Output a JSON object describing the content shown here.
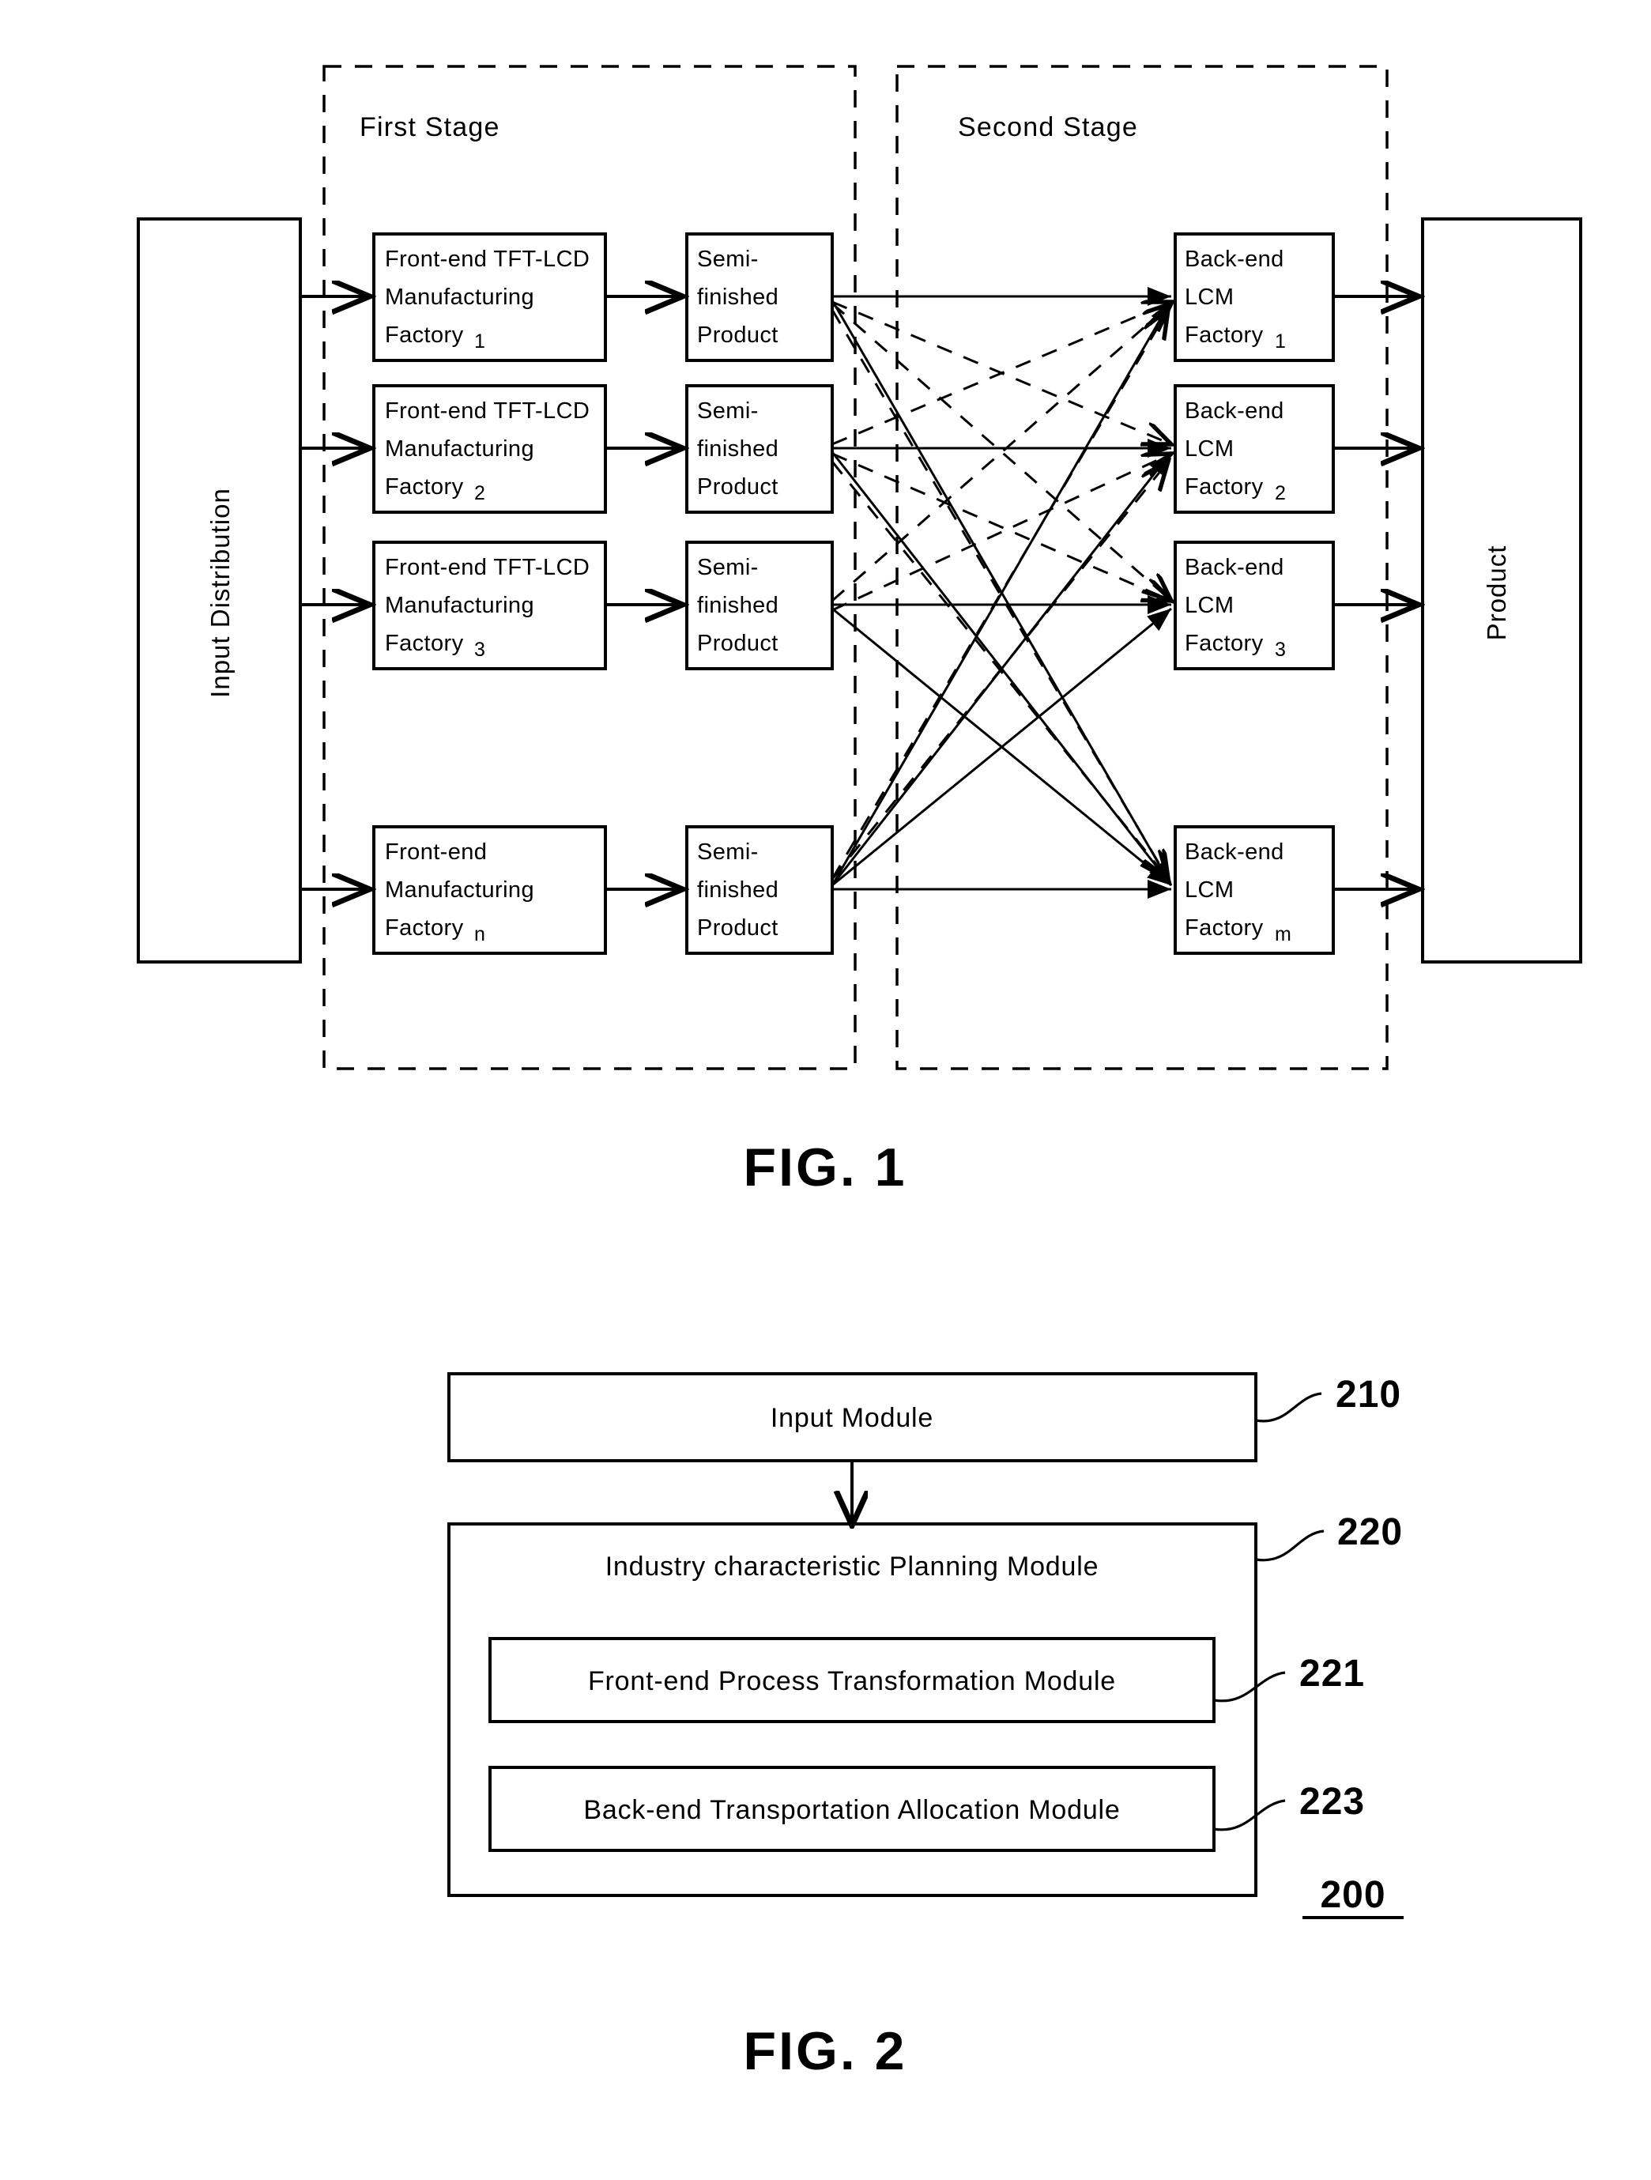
{
  "figure1": {
    "caption": "FIG. 1",
    "stages": [
      {
        "id": "first-stage",
        "label": "First Stage"
      },
      {
        "id": "second-stage",
        "label": "Second Stage"
      }
    ],
    "input_block": {
      "label": "Input Distribution"
    },
    "output_block": {
      "label": "Product"
    },
    "frontend_factories": [
      {
        "line1": "Front-end TFT-LCD",
        "line2": "Manufacturing",
        "line3": "Factory",
        "index": "1"
      },
      {
        "line1": "Front-end TFT-LCD",
        "line2": "Manufacturing",
        "line3": "Factory",
        "index": "2"
      },
      {
        "line1": "Front-end TFT-LCD",
        "line2": "Manufacturing",
        "line3": "Factory",
        "index": "3"
      },
      {
        "line1": "Front-end",
        "line2": "Manufacturing",
        "line3": "Factory",
        "index": "n"
      }
    ],
    "semifinished": [
      {
        "line1": "Semi-",
        "line2": "finished",
        "line3": "Product"
      },
      {
        "line1": "Semi-",
        "line2": "finished",
        "line3": "Product"
      },
      {
        "line1": "Semi-",
        "line2": "finished",
        "line3": "Product"
      },
      {
        "line1": "Semi-",
        "line2": "finished",
        "line3": "Product"
      }
    ],
    "backend_factories": [
      {
        "line1": "Back-end",
        "line2": "LCM",
        "line3": "Factory",
        "index": "1"
      },
      {
        "line1": "Back-end",
        "line2": "LCM",
        "line3": "Factory",
        "index": "2"
      },
      {
        "line1": "Back-end",
        "line2": "LCM",
        "line3": "Factory",
        "index": "3"
      },
      {
        "line1": "Back-end",
        "line2": "LCM",
        "line3": "Factory",
        "index": "m"
      }
    ]
  },
  "figure2": {
    "caption": "FIG. 2",
    "system_ref": "200",
    "input_module": {
      "label": "Input Module",
      "ref": "210"
    },
    "planning_module": {
      "label": "Industry characteristic Planning Module",
      "ref": "220"
    },
    "submodules": [
      {
        "label": "Front-end Process Transformation Module",
        "ref": "221"
      },
      {
        "label": "Back-end Transportation Allocation Module",
        "ref": "223"
      }
    ]
  },
  "colors": {
    "ink": "#000000",
    "paper": "#ffffff"
  }
}
